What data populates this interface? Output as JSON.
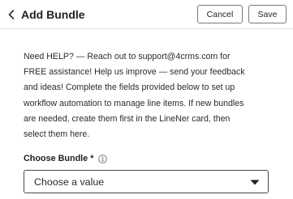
{
  "header": {
    "title": "Add Bundle",
    "back_icon": "chevron-left-icon",
    "cancel_label": "Cancel",
    "save_label": "Save"
  },
  "help": {
    "lines": [
      "Need HELP? — Reach out to support@4crms.com for",
      "FREE assistance! Help us improve — send your feedback",
      "and ideas! Complete the fields provided below to set up",
      "workflow automation to manage line items. If new bundles",
      "are needed, create them first in the LineNer card, then",
      "select them here."
    ]
  },
  "bundle_field": {
    "label": "Choose Bundle",
    "required_mark": "*",
    "info_icon": "info-circle-icon",
    "selected_value": "Choose a value",
    "caret_icon": "caret-down-icon"
  },
  "colors": {
    "text": "#2b2b2b",
    "border": "#7a7a7a",
    "divider": "#e2e2e2",
    "background": "#ffffff"
  }
}
